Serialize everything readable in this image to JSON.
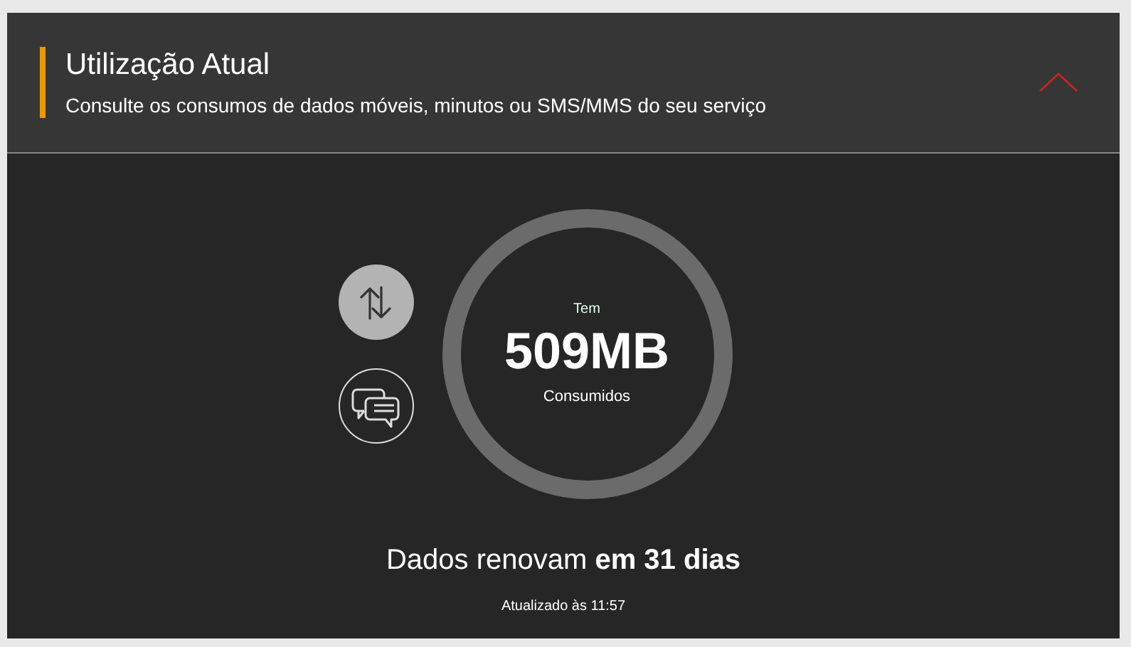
{
  "header": {
    "title": "Utilização Atual",
    "subtitle": "Consulte os consumos de dados móveis, minutos ou SMS/MMS do seu serviço",
    "expanded": true
  },
  "usage_tabs": [
    {
      "kind": "data",
      "selected": true
    },
    {
      "kind": "messages",
      "selected": false
    }
  ],
  "gauge": {
    "top": "Tem",
    "value": "509MB",
    "bottom": "Consumidos"
  },
  "renewal": "Dados renovam **em 31 dias**",
  "updated": "Atualizado às 11:57"
}
